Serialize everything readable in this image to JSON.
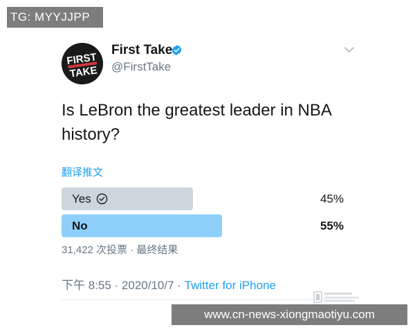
{
  "overlay": {
    "top_left": "TG: MYYJJPP",
    "bottom_url": "www.cn-news-xiongmaotiyu.com"
  },
  "author": {
    "name": "First Take",
    "handle": "@FirstTake",
    "avatar_text_line1": "FIRST",
    "avatar_text_line2": "TAKE",
    "verified_color": "#1da1f2"
  },
  "tweet": {
    "text_line1": "Is LeBron the greatest leader in NBA",
    "text_line2": "history?",
    "translate_label": "翻译推文"
  },
  "poll": {
    "options": [
      {
        "label": "Yes",
        "percent": "45%",
        "value": 45,
        "voted": true
      },
      {
        "label": "No",
        "percent": "55%",
        "value": 55,
        "winner": true
      }
    ],
    "meta": "31,422 次投票 · 最终结果"
  },
  "footer": {
    "time": "下午 8:55",
    "separator1": " · ",
    "date": "2020/10/7",
    "separator2": " · ",
    "source": "Twitter for iPhone"
  },
  "colors": {
    "accent": "#1da1f2",
    "winner_bar": "#8ed0f9",
    "other_bar": "#ccd6dd",
    "muted": "#657786"
  },
  "icons": [
    "verified-badge-icon",
    "chevron-down-icon",
    "check-circle-icon"
  ]
}
